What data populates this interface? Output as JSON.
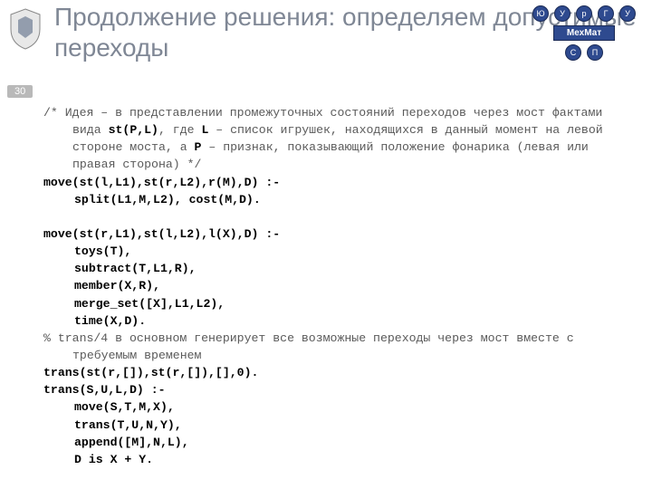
{
  "page_number": "30",
  "title": "Продолжение решения: определяем допустимые переходы",
  "diagram": {
    "top": [
      "Ю",
      "У",
      "р",
      "Г",
      "У"
    ],
    "mid": "МехМат",
    "bottom": [
      "С",
      "П"
    ]
  },
  "code": {
    "c1a": "/* Идея – в представлении промежуточных состояний переходов через мост фактами вида ",
    "c1b": "st(P,L)",
    "c1c": ", где ",
    "c1d": "L",
    "c1e": " – список игрушек, находящихся в данный момент на левой стороне моста, а ",
    "c1f": "P",
    "c1g": " – признак, показывающий положение фонарика (левая или правая сторона) */",
    "l1": "move(st(l,L1),st(r,L2),r(M),D) :-",
    "l2": "split(L1,M,L2), cost(M,D).",
    "l3": "move(st(r,L1),st(l,L2),l(X),D) :-",
    "l4": "toys(T),",
    "l5": "subtract(T,L1,R),",
    "l6": "member(X,R),",
    "l7": "merge_set([X],L1,L2),",
    "l8": "time(X,D).",
    "c2": "% trans/4 в основном генерирует все возможные переходы через мост вместе с требуемым временем",
    "l9": "trans(st(r,[]),st(r,[]),[],0).",
    "l10": "trans(S,U,L,D) :-",
    "l11": "move(S,T,M,X),",
    "l12": "trans(T,U,N,Y),",
    "l13": "append([M],N,L),",
    "l14": "D is X + Y."
  }
}
